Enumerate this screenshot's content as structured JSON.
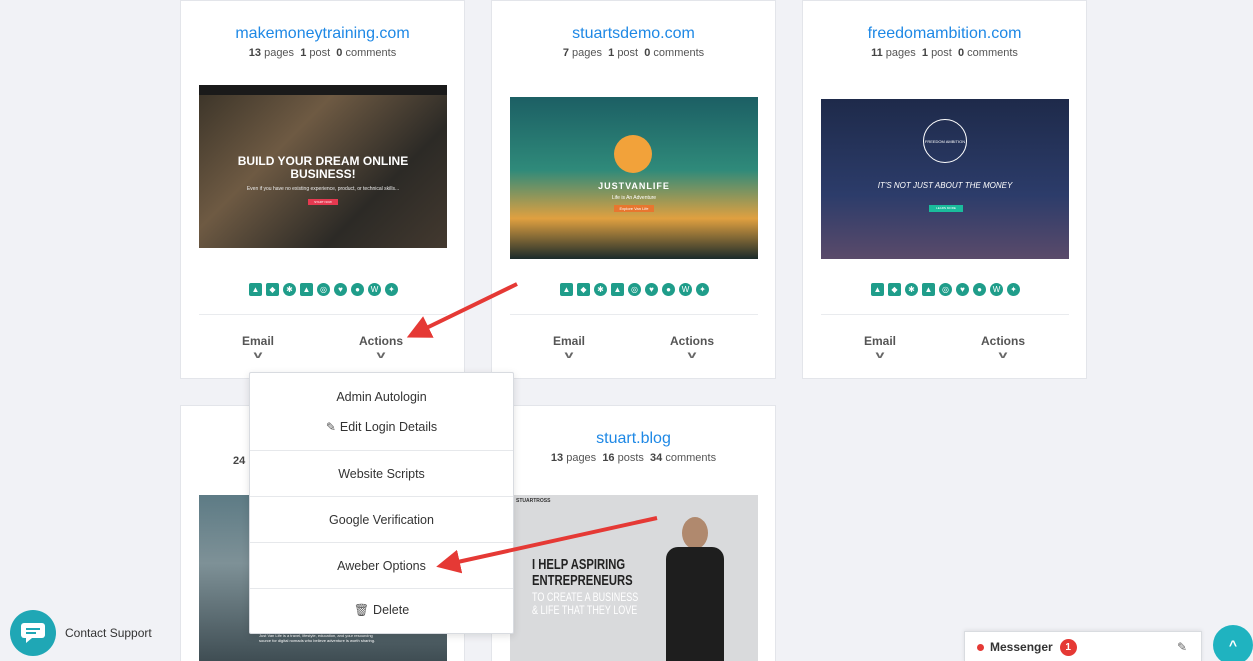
{
  "cards": [
    {
      "title": "makemoneytraining.com",
      "pages": "13",
      "pages_label": "pages",
      "posts": "1",
      "posts_label": "post",
      "comments": "0",
      "comments_label": "comments",
      "preview_headline": "BUILD YOUR DREAM ONLINE BUSINESS!",
      "preview_sub": "Even if you have no existing experience, product, or technical skills...",
      "preview_cta": "START NOW"
    },
    {
      "title": "stuartsdemo.com",
      "pages": "7",
      "pages_label": "pages",
      "posts": "1",
      "posts_label": "post",
      "comments": "0",
      "comments_label": "comments",
      "preview_headline": "JUSTVANLIFE",
      "preview_sub": "Life is An Adventure",
      "preview_cta": "Explore Van Life"
    },
    {
      "title": "freedomambition.com",
      "pages": "11",
      "pages_label": "pages",
      "posts": "1",
      "posts_label": "post",
      "comments": "0",
      "comments_label": "comments",
      "preview_headline": "IT'S NOT JUST ABOUT THE MONEY",
      "preview_logo": "FREEDOM AMBITION",
      "preview_cta": "LEARN MORE"
    },
    {
      "title": "",
      "pages": "24",
      "pages_label": "",
      "posts": "",
      "posts_label": "",
      "comments": "",
      "comments_label": "",
      "preview_sub": "Just Van Life is a travel, lifestyle, education, and your resourcing source for digital nomads who believe adventure is worth sharing."
    },
    {
      "title": "stuart.blog",
      "pages": "13",
      "pages_label": "pages",
      "posts": "16",
      "posts_label": "posts",
      "comments": "34",
      "comments_label": "comments",
      "preview_brand": "STUARTROSS",
      "preview_headline_1": "I HELP ASPIRING",
      "preview_headline_2": "ENTREPRENEURS",
      "preview_sub_1": "TO CREATE A BUSINESS",
      "preview_sub_2": "& LIFE THAT THEY LOVE"
    }
  ],
  "actions": {
    "email": "Email",
    "actions": "Actions"
  },
  "dropdown": {
    "admin_autologin": "Admin Autologin",
    "edit_login": "Edit Login Details",
    "website_scripts": "Website Scripts",
    "google_verification": "Google Verification",
    "aweber_options": "Aweber Options",
    "delete": "Delete"
  },
  "support": {
    "label": "Contact Support"
  },
  "messenger": {
    "label": "Messenger",
    "badge": "1"
  },
  "colors": {
    "link": "#1e88e5",
    "teal": "#1f9d8a",
    "arrow": "#e53935"
  }
}
